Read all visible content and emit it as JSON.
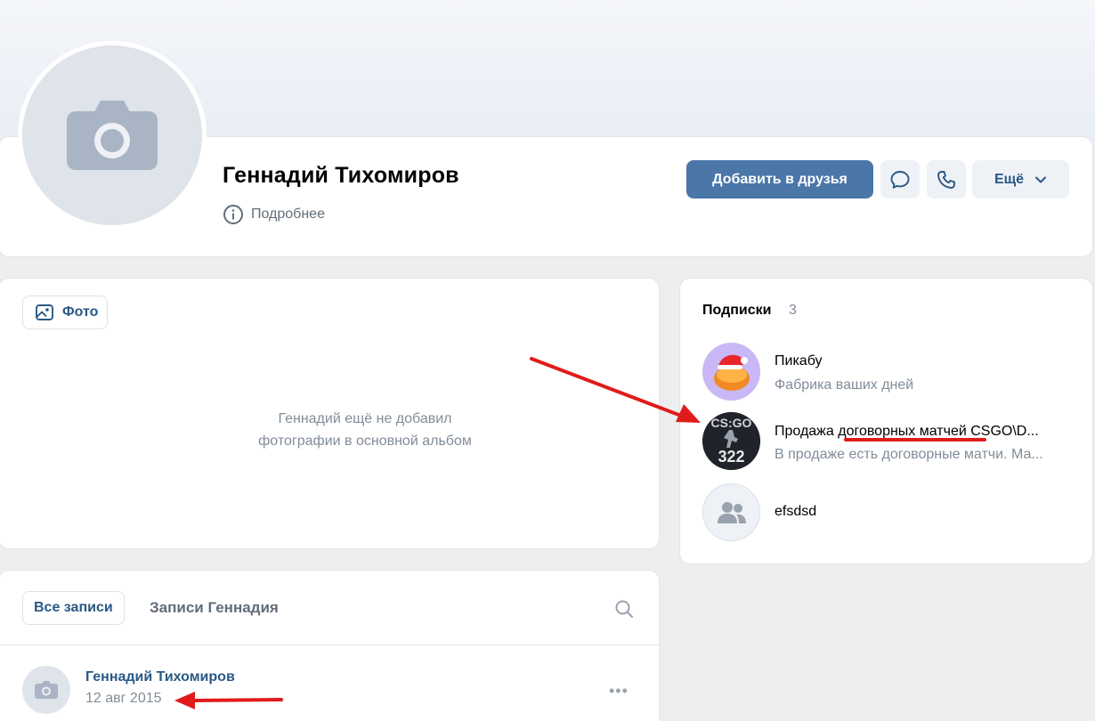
{
  "profile": {
    "name": "Геннадий Тихомиров",
    "more_info": "Подробнее"
  },
  "actions": {
    "add_friend": "Добавить в друзья",
    "more": "Ещё"
  },
  "photos": {
    "chip_label": "Фото",
    "empty_line1": "Геннадий ещё не добавил",
    "empty_line2": "фотографии в основной альбом"
  },
  "subscriptions": {
    "title": "Подписки",
    "count": "3",
    "items": [
      {
        "name": "Пикабу",
        "desc": "Фабрика ваших дней"
      },
      {
        "name_prefix": "Продажа ",
        "name_highlight": "договорных матчей",
        "name_suffix": " CSGO\\D...",
        "desc": "В продаже есть договорные матчи. Ма...",
        "avatar_top": "CS:GO",
        "avatar_bottom": "322"
      },
      {
        "name": "efsdsd"
      }
    ]
  },
  "posts": {
    "tabs": [
      {
        "label": "Все записи",
        "active": true
      },
      {
        "label": "Записи Геннадия",
        "active": false
      }
    ],
    "post": {
      "author": "Геннадий Тихомиров",
      "date": "12 авг 2015",
      "menu": "•••"
    }
  },
  "colors": {
    "accent": "#4a76a8",
    "link": "#2a5885",
    "annotation": "#e01b1b"
  }
}
